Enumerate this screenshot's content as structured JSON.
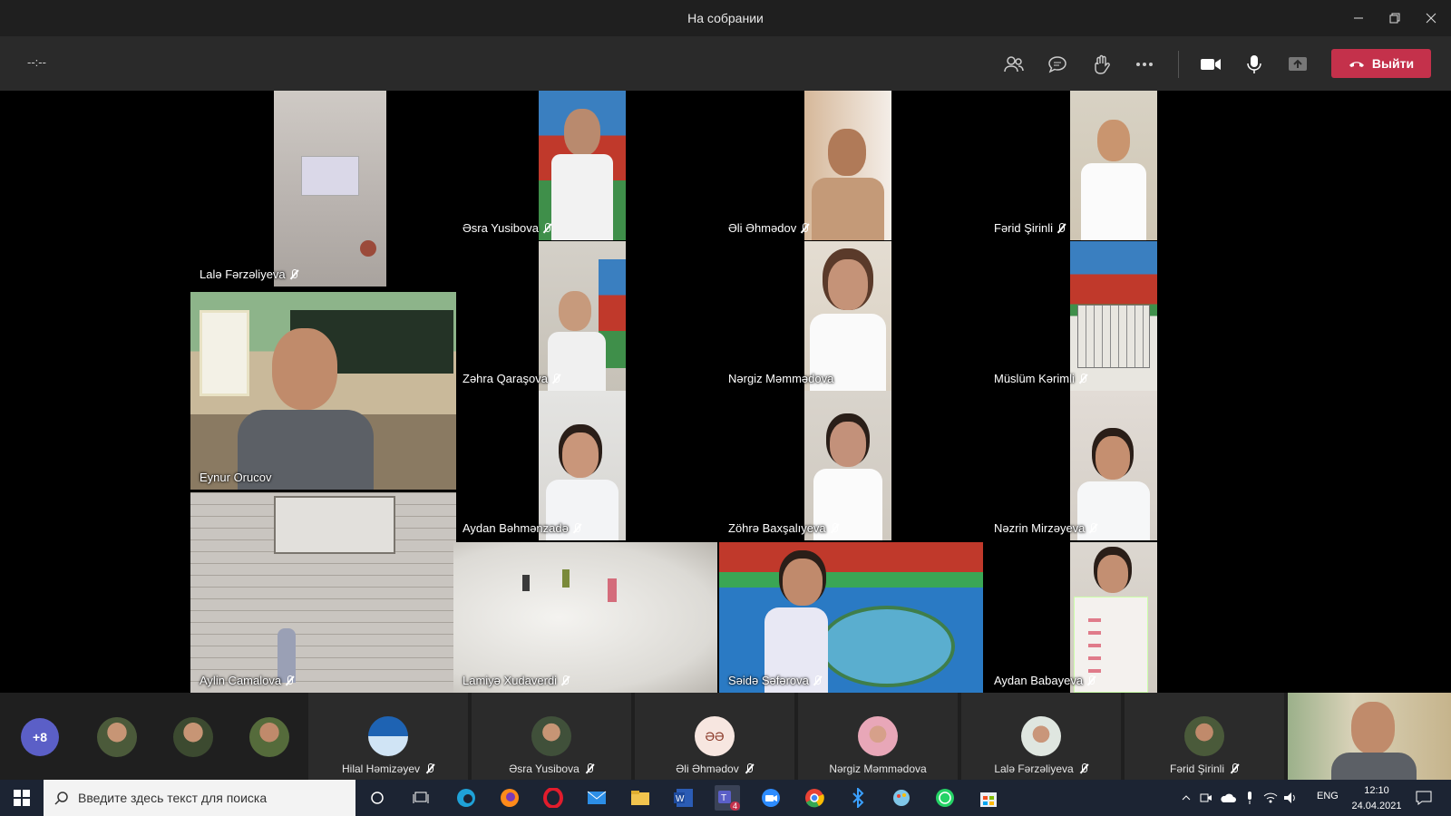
{
  "window": {
    "title": "На собрании"
  },
  "toolbar": {
    "timer": "--:--",
    "leave_label": "Выйти"
  },
  "tiles": [
    {
      "name": "Lalə Fərzəliyeva",
      "muted": true
    },
    {
      "name": "Əsra Yusibova",
      "muted": true
    },
    {
      "name": "Əli Əhmədov",
      "muted": true
    },
    {
      "name": "Fərid Şirinli",
      "muted": true
    },
    {
      "name": "Eynur Orucov",
      "muted": false
    },
    {
      "name": "Zəhra Qaraşova",
      "muted": true
    },
    {
      "name": "Nərgiz Məmmədova",
      "muted": false
    },
    {
      "name": "Müslüm Kərimli",
      "muted": true
    },
    {
      "name": "Aydan Bəhmənzadə",
      "muted": true
    },
    {
      "name": "Zöhrə Baxşalıyeva",
      "muted": true
    },
    {
      "name": "Nəzrin Mirzəyeva",
      "muted": true
    },
    {
      "name": "Aylin Camalova",
      "muted": true
    },
    {
      "name": "Lamiyə Xudaverdi",
      "muted": true
    },
    {
      "name": "Səidə Səfərova",
      "muted": true
    },
    {
      "name": "Aydan Babayeva",
      "muted": true
    }
  ],
  "strip": {
    "more_count": "+8",
    "participants": [
      {
        "name": "Hilal Həmizəyev",
        "muted": true
      },
      {
        "name": "Əsra Yusibova",
        "muted": true
      },
      {
        "name": "Əli Əhmədov",
        "muted": true,
        "initials": "ƏƏ"
      },
      {
        "name": "Nərgiz Məmmədova",
        "muted": false
      },
      {
        "name": "Lalə Fərzəliyeva",
        "muted": true
      },
      {
        "name": "Fərid Şirinli",
        "muted": true
      }
    ]
  },
  "taskbar": {
    "search_placeholder": "Введите здесь текст для поиска",
    "lang": "ENG",
    "time": "12:10",
    "date": "24.04.2021",
    "teams_badge": "4"
  },
  "colors": {
    "leave": "#c4314b",
    "accent": "#5b5fc7",
    "taskbar": "#1c2433"
  }
}
